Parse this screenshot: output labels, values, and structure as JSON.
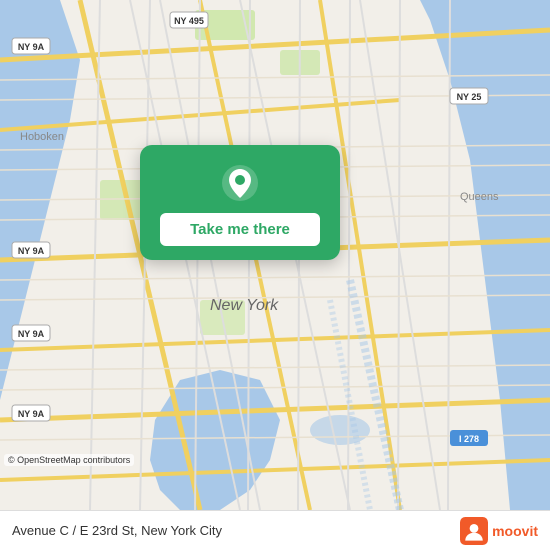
{
  "map": {
    "attribution": "© OpenStreetMap contributors"
  },
  "overlay": {
    "button_label": "Take me there",
    "pin_color": "#ffffff"
  },
  "bottom_bar": {
    "location": "Avenue C / E 23rd St, New York City",
    "logo_text": "moovit"
  }
}
